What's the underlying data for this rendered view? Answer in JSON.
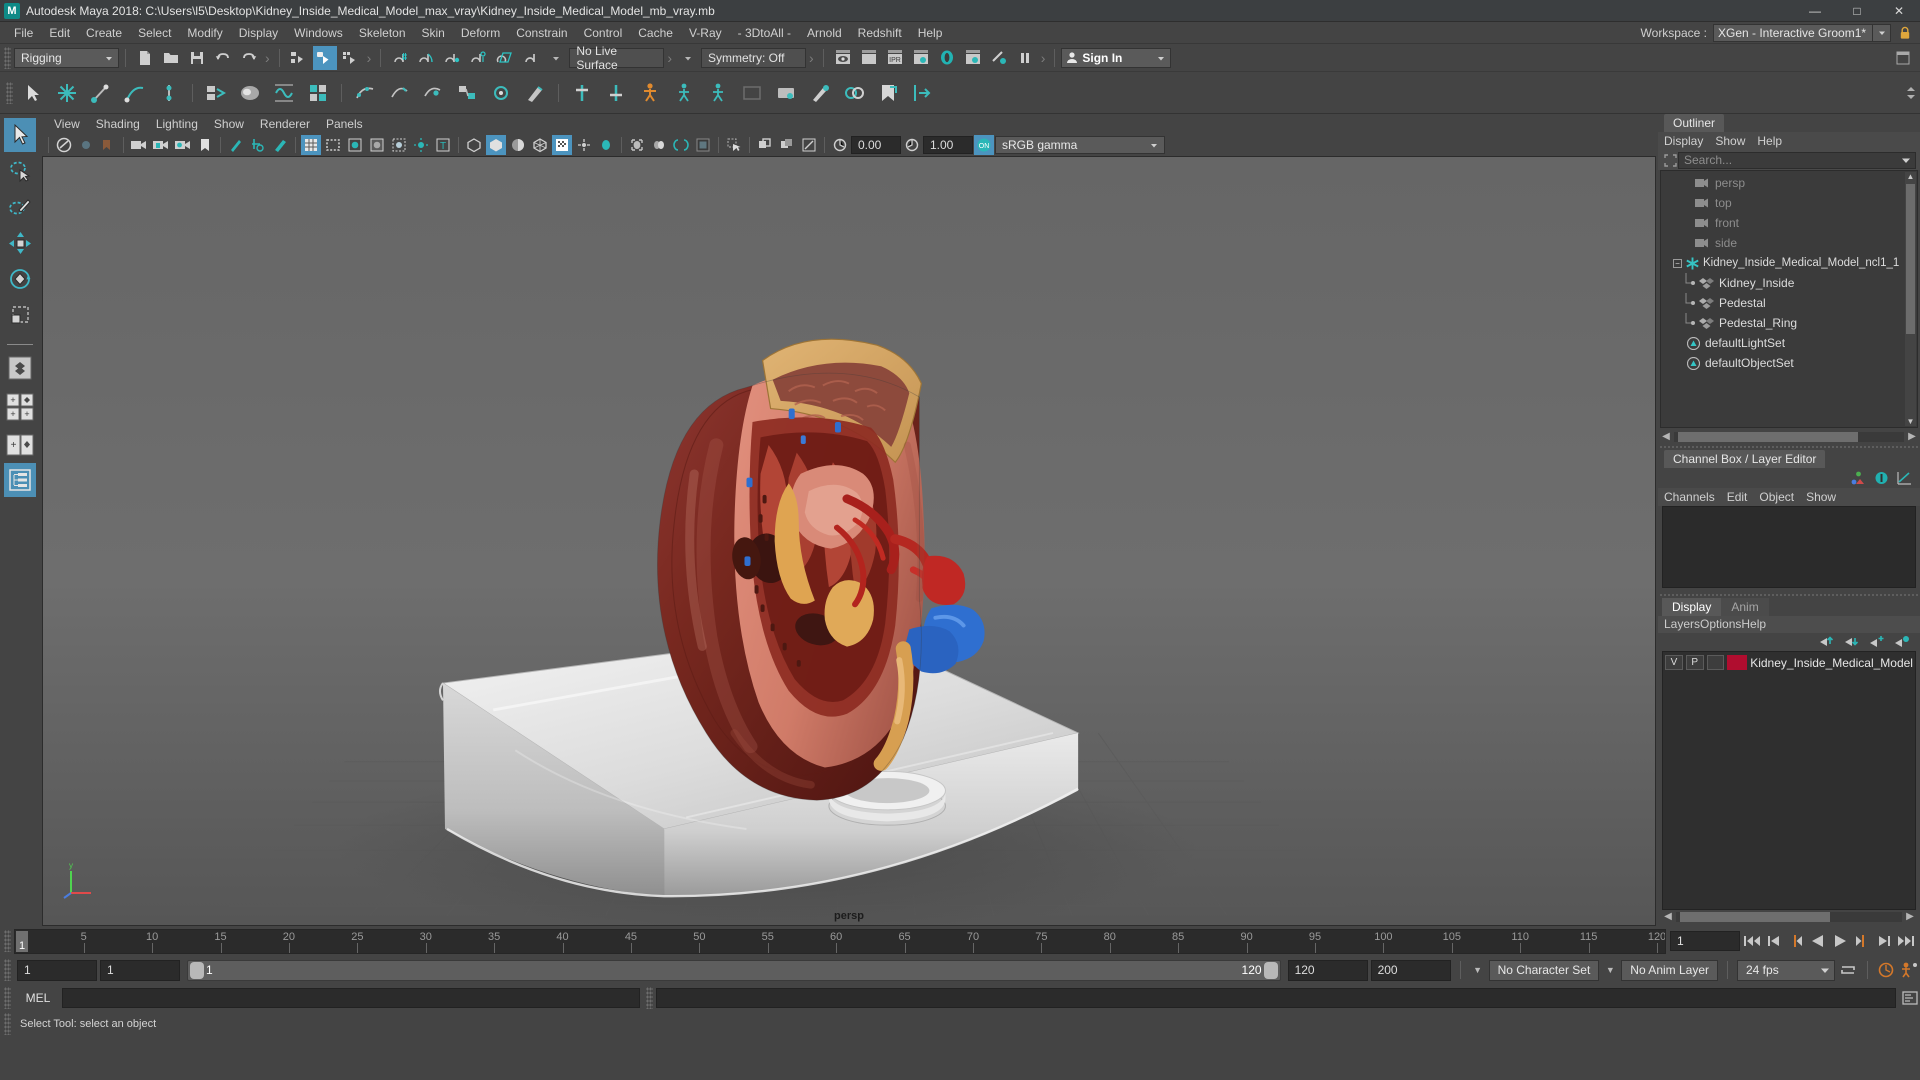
{
  "titlebar": {
    "app_title": "Autodesk Maya 2018: C:\\Users\\l5\\Desktop\\Kidney_Inside_Medical_Model_max_vray\\Kidney_Inside_Medical_Model_mb_vray.mb",
    "logo_text": "M",
    "minimize": "—",
    "maximize": "□",
    "close": "✕"
  },
  "menubar": {
    "items": [
      "File",
      "Edit",
      "Create",
      "Select",
      "Modify",
      "Display",
      "Windows",
      "Skeleton",
      "Skin",
      "Deform",
      "Constrain",
      "Control",
      "Cache",
      "V-Ray",
      "- 3DtoAll -",
      "Arnold",
      "Redshift",
      "Help"
    ],
    "workspace_label": "Workspace :",
    "workspace_value": "XGen - Interactive Groom1*"
  },
  "statusline": {
    "menuset": "Rigging",
    "live_surface": "No Live Surface",
    "symmetry": "Symmetry: Off",
    "signin": "Sign In"
  },
  "viewport_panel": {
    "menus": [
      "View",
      "Shading",
      "Lighting",
      "Show",
      "Renderer",
      "Panels"
    ],
    "exposure": "0.00",
    "gamma": "1.00",
    "color_mgmt": "sRGB gamma",
    "camera_label": "persp",
    "axis_y": "y",
    "axis_x": "x",
    "axis_z": "z"
  },
  "outliner": {
    "tab": "Outliner",
    "menus": [
      "Display",
      "Show",
      "Help"
    ],
    "search_placeholder": "Search...",
    "items": [
      {
        "label": "persp",
        "icon": "camera-icon",
        "type": "camera",
        "indent": 1
      },
      {
        "label": "top",
        "icon": "camera-icon",
        "type": "camera",
        "indent": 1
      },
      {
        "label": "front",
        "icon": "camera-icon",
        "type": "camera",
        "indent": 1
      },
      {
        "label": "side",
        "icon": "camera-icon",
        "type": "camera",
        "indent": 1
      },
      {
        "label": "Kidney_Inside_Medical_Model_ncl1_1",
        "icon": "group-asterisk-icon",
        "type": "group",
        "indent": 0,
        "expanded": true
      },
      {
        "label": "Kidney_Inside",
        "icon": "mesh-icon",
        "type": "mesh",
        "indent": 2
      },
      {
        "label": "Pedestal",
        "icon": "mesh-icon",
        "type": "mesh",
        "indent": 2
      },
      {
        "label": "Pedestal_Ring",
        "icon": "mesh-icon",
        "type": "mesh",
        "indent": 2
      },
      {
        "label": "defaultLightSet",
        "icon": "set-icon",
        "type": "set",
        "indent": 1
      },
      {
        "label": "defaultObjectSet",
        "icon": "set-icon",
        "type": "set",
        "indent": 1
      }
    ]
  },
  "channelbox": {
    "tab": "Channel Box / Layer Editor",
    "menus": [
      "Channels",
      "Edit",
      "Object",
      "Show"
    ]
  },
  "layer_editor": {
    "tabs": [
      "Display",
      "Anim"
    ],
    "active_tab": "Display",
    "menus": [
      "Layers",
      "Options",
      "Help"
    ],
    "layers": [
      {
        "visibility": "V",
        "playback": "P",
        "shading": "",
        "color": "#b00d2f",
        "name": "Kidney_Inside_Medical_Model"
      }
    ]
  },
  "timeslider": {
    "current_frame": "1",
    "start": 1,
    "end": 120,
    "tick_labels": [
      5,
      10,
      15,
      20,
      25,
      30,
      35,
      40,
      45,
      50,
      55,
      60,
      65,
      70,
      75,
      80,
      85,
      90,
      95,
      100,
      105,
      110,
      115,
      120
    ],
    "current_frame_field": "1"
  },
  "rangeslider": {
    "anim_start": "1",
    "range_start": "1",
    "bar_start": "1",
    "bar_end": "120",
    "range_end": "120",
    "anim_end": "200",
    "character_set": "No Character Set",
    "anim_layer": "No Anim Layer",
    "fps": "24 fps"
  },
  "commandline": {
    "mel_label": "MEL",
    "command_value": ""
  },
  "helpline": {
    "text": "Select Tool: select an object"
  }
}
